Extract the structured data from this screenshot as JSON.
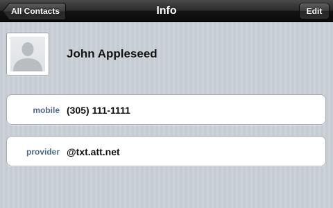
{
  "navbar": {
    "back_label": "All Contacts",
    "title": "Info",
    "edit_label": "Edit"
  },
  "contact": {
    "name": "John Appleseed",
    "avatar_icon": "person-silhouette-icon"
  },
  "fields": [
    {
      "label": "mobile",
      "value": "(305) 111-1111"
    },
    {
      "label": "provider",
      "value": "@txt.att.net"
    }
  ],
  "colors": {
    "background": "#c5ccd4",
    "label_blue": "#4d6b8f",
    "navbar_dark": "#141414"
  }
}
